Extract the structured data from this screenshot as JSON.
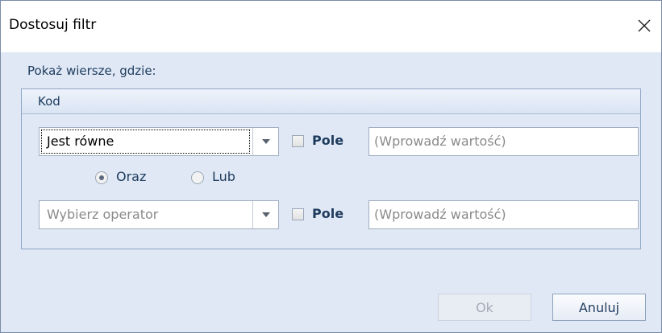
{
  "window": {
    "title": "Dostosuj filtr",
    "close_icon": "close-icon"
  },
  "main": {
    "show_rows_label": "Pokaż wiersze, gdzie:",
    "group": {
      "column_name": "Kod",
      "condition1": {
        "operator": "Jest równe",
        "field_label": "Pole",
        "field_checked": false,
        "value_placeholder": "(Wprowadź wartość)"
      },
      "logic": {
        "and_label": "Oraz",
        "or_label": "Lub",
        "selected": "Oraz"
      },
      "condition2": {
        "operator_placeholder": "Wybierz operator",
        "field_label": "Pole",
        "field_checked": false,
        "value_placeholder": "(Wprowadź wartość)"
      }
    }
  },
  "footer": {
    "ok_label": "Ok",
    "ok_enabled": false,
    "cancel_label": "Anuluj"
  },
  "colors": {
    "dialog_background": "#dfe8f4",
    "label_text": "#1e3b5e",
    "placeholder_text": "#8a8a8a",
    "disabled_text": "#a4acb7"
  }
}
